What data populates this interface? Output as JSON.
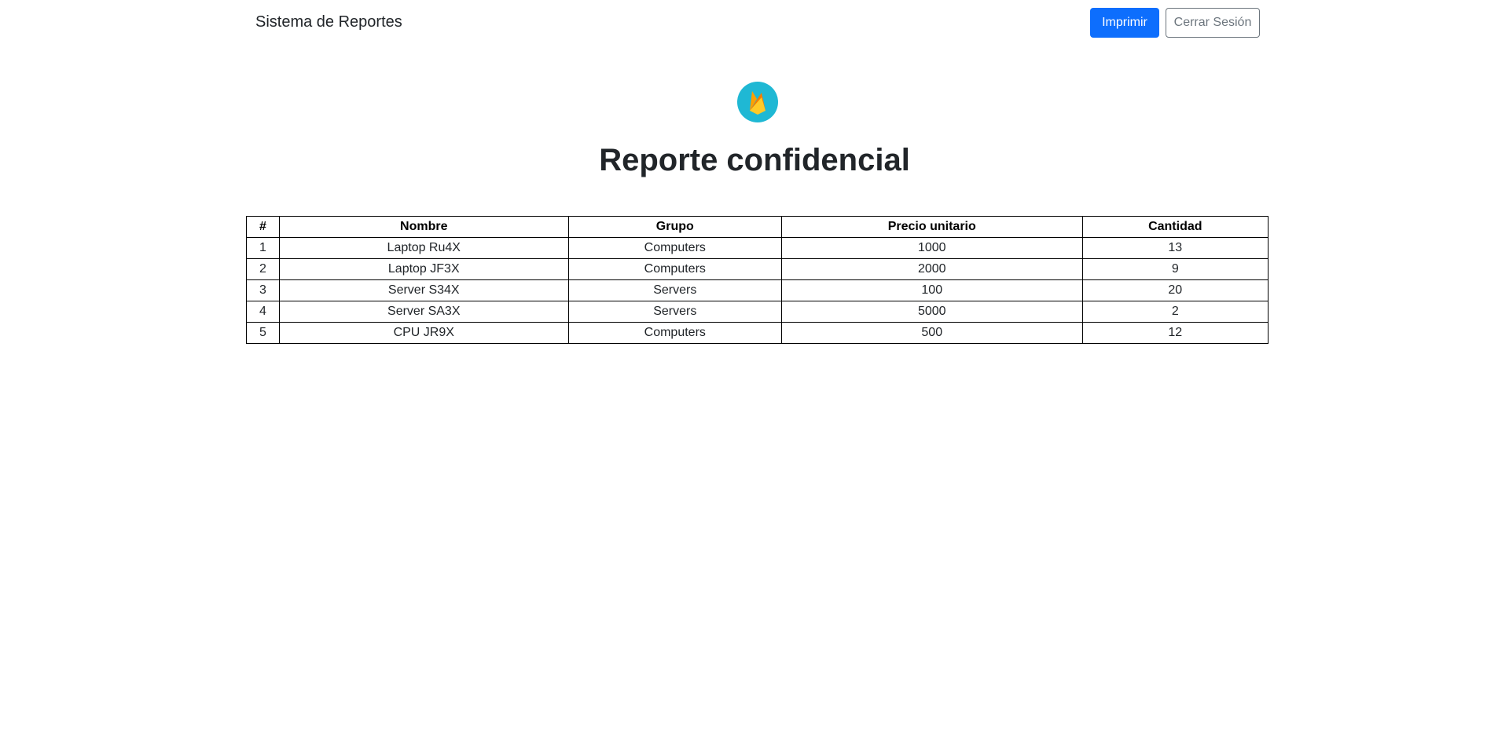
{
  "navbar": {
    "brand": "Sistema de Reportes",
    "print_label": "Imprimir",
    "logout_label": "Cerrar Sesión"
  },
  "logo": {
    "icon": "firebase-flame-icon",
    "bg_color": "#1fb8d4",
    "flame_colors": [
      "#ffa000",
      "#f57c00",
      "#ffca28"
    ]
  },
  "main": {
    "title": "Reporte confidencial"
  },
  "table": {
    "headers": [
      "#",
      "Nombre",
      "Grupo",
      "Precio unitario",
      "Cantidad"
    ],
    "rows": [
      [
        "1",
        "Laptop Ru4X",
        "Computers",
        "1000",
        "13"
      ],
      [
        "2",
        "Laptop JF3X",
        "Computers",
        "2000",
        "9"
      ],
      [
        "3",
        "Server S34X",
        "Servers",
        "100",
        "20"
      ],
      [
        "4",
        "Server SA3X",
        "Servers",
        "5000",
        "2"
      ],
      [
        "5",
        "CPU JR9X",
        "Computers",
        "500",
        "12"
      ]
    ]
  },
  "colors": {
    "primary": "#0d6efd",
    "secondary": "#6c757d",
    "text": "#212529"
  }
}
